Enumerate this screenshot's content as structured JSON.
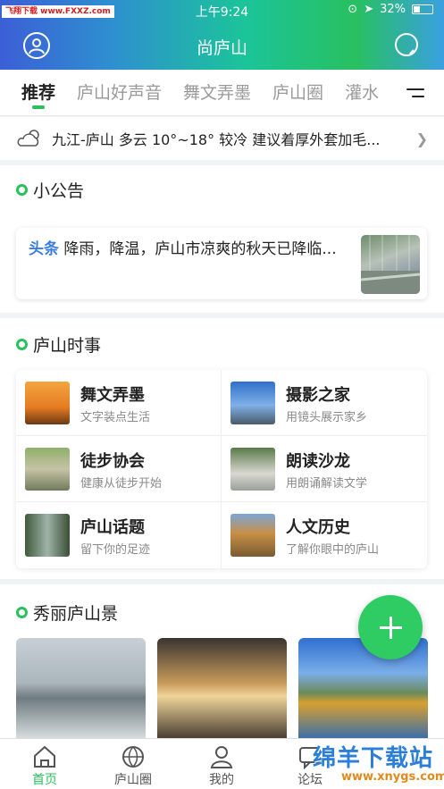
{
  "status": {
    "watermark": "飞翔下载 www.FXXZ.com",
    "time": "上午9:24",
    "battery": "32%"
  },
  "header": {
    "title": "尚庐山"
  },
  "tabs": [
    {
      "label": "推荐",
      "active": true
    },
    {
      "label": "庐山好声音"
    },
    {
      "label": "舞文弄墨"
    },
    {
      "label": "庐山圈"
    },
    {
      "label": "灌水"
    }
  ],
  "weather": {
    "text": "九江-庐山 多云 10°~18° 较冷 建议着厚外套加毛..."
  },
  "notice": {
    "title": "小公告",
    "tag": "头条",
    "text": "降雨，降温，庐山市凉爽的秋天已降临..."
  },
  "news": {
    "title": "庐山时事",
    "items": [
      {
        "title": "舞文弄墨",
        "subtitle": "文字装点生活"
      },
      {
        "title": "摄影之家",
        "subtitle": "用镜头展示家乡"
      },
      {
        "title": "徒步协会",
        "subtitle": "健康从徒步开始"
      },
      {
        "title": "朗读沙龙",
        "subtitle": "用朗诵解读文学"
      },
      {
        "title": "庐山话题",
        "subtitle": "留下你的足迹"
      },
      {
        "title": "人文历史",
        "subtitle": "了解你眼中的庐山"
      }
    ]
  },
  "scenic": {
    "title": "秀丽庐山景"
  },
  "bottom_nav": [
    {
      "label": "首页",
      "icon": "home-icon",
      "active": true
    },
    {
      "label": "庐山圈",
      "icon": "globe-icon"
    },
    {
      "label": "我的",
      "icon": "user-icon"
    },
    {
      "label": "论坛",
      "icon": "forum-icon"
    }
  ],
  "overlay_logo": {
    "text": "绵羊下载站",
    "url": "www.xnygs.com"
  },
  "colors": {
    "accent": "#29c15c",
    "tag_blue": "#3b7ee0"
  }
}
